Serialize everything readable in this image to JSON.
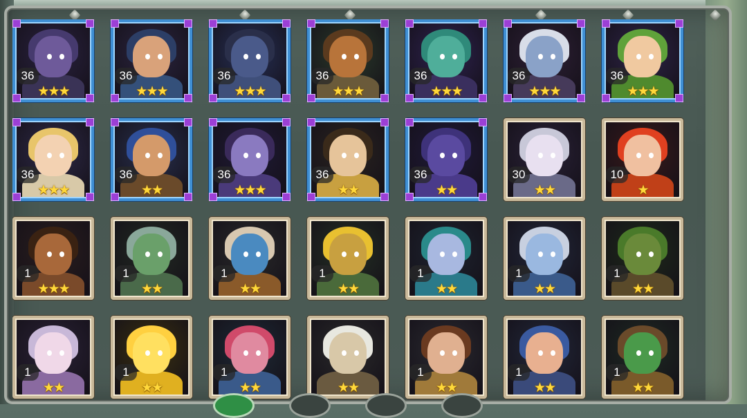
{
  "heroes": [
    {
      "level": "36",
      "stars": 3,
      "frame": "blue",
      "skin": "#6e5a9a",
      "hair": "#463a6e",
      "bg": "#2a2240",
      "outfit": "#3a3356"
    },
    {
      "level": "36",
      "stars": 3,
      "frame": "blue",
      "skin": "#d9a27a",
      "hair": "#2c3e66",
      "bg": "#2b2540",
      "outfit": "#34507a"
    },
    {
      "level": "36",
      "stars": 3,
      "frame": "blue",
      "skin": "#4a5a8a",
      "hair": "#2a2f4a",
      "bg": "#263056",
      "outfit": "#3f4f7a"
    },
    {
      "level": "36",
      "stars": 3,
      "frame": "blue",
      "skin": "#b8743a",
      "hair": "#5a3a1e",
      "bg": "#2a3a2a",
      "outfit": "#6a5a3a"
    },
    {
      "level": "36",
      "stars": 3,
      "frame": "blue",
      "skin": "#4fae9a",
      "hair": "#2f8a7a",
      "bg": "#2e2250",
      "outfit": "#3a2f5e"
    },
    {
      "level": "36",
      "stars": 3,
      "frame": "blue",
      "skin": "#8aa2c8",
      "hair": "#d8dde8",
      "bg": "#2e2036",
      "outfit": "#463a5a"
    },
    {
      "level": "36",
      "stars": 3,
      "frame": "blue",
      "skin": "#f0c9a0",
      "hair": "#5fa23a",
      "bg": "#2e2448",
      "outfit": "#4f8a2e"
    },
    {
      "level": "36",
      "stars": 3,
      "frame": "blue",
      "skin": "#f3d2b2",
      "hair": "#e8c56a",
      "bg": "#2e2a48",
      "outfit": "#d8c9a8"
    },
    {
      "level": "36",
      "stars": 2,
      "frame": "blue",
      "skin": "#d49a6a",
      "hair": "#2f4f9a",
      "bg": "#28304e",
      "outfit": "#6a4a2a"
    },
    {
      "level": "36",
      "stars": 3,
      "frame": "blue",
      "skin": "#8a7ac0",
      "hair": "#3a2a5a",
      "bg": "#1f1a36",
      "outfit": "#4a3a7a"
    },
    {
      "level": "36",
      "stars": 2,
      "frame": "blue",
      "skin": "#e6c49a",
      "hair": "#3a2a1a",
      "bg": "#2a2420",
      "outfit": "#c8a040"
    },
    {
      "level": "36",
      "stars": 2,
      "frame": "blue",
      "skin": "#5a4aa0",
      "hair": "#3e327a",
      "bg": "#201a3a",
      "outfit": "#4a3a8a"
    },
    {
      "level": "30",
      "stars": 2,
      "frame": "gold",
      "skin": "#e8e0f0",
      "hair": "#c8c8d8",
      "bg": "#2a2238",
      "outfit": "#6a6a88"
    },
    {
      "level": "10",
      "stars": 1,
      "frame": "gold",
      "skin": "#f0c0a0",
      "hair": "#e04020",
      "bg": "#3a1a1a",
      "outfit": "#c04018"
    },
    {
      "level": "1",
      "stars": 3,
      "frame": "gold",
      "skin": "#a8683a",
      "hair": "#3a2212",
      "bg": "#2a1e1e",
      "outfit": "#7a4a2a"
    },
    {
      "level": "1",
      "stars": 2,
      "frame": "gold",
      "skin": "#6aa06a",
      "hair": "#8aa89a",
      "bg": "#222a22",
      "outfit": "#4a6a4a"
    },
    {
      "level": "1",
      "stars": 2,
      "frame": "gold",
      "skin": "#4a8ac0",
      "hair": "#d8c8b0",
      "bg": "#2a2a2a",
      "outfit": "#8a5a2a"
    },
    {
      "level": "1",
      "stars": 2,
      "frame": "gold",
      "skin": "#c8a040",
      "hair": "#e8c030",
      "bg": "#243024",
      "outfit": "#4a6a3a"
    },
    {
      "level": "1",
      "stars": 2,
      "frame": "gold",
      "skin": "#a8b8e0",
      "hair": "#2a8a8a",
      "bg": "#1e2430",
      "outfit": "#2a7a8a"
    },
    {
      "level": "1",
      "stars": 2,
      "frame": "gold",
      "skin": "#9ab8e0",
      "hair": "#c8d0e0",
      "bg": "#22283a",
      "outfit": "#3a5a8a"
    },
    {
      "level": "1",
      "stars": 2,
      "frame": "gold",
      "skin": "#6a8a3a",
      "hair": "#4a7a2a",
      "bg": "#1e2a1a",
      "outfit": "#5a4a2a"
    },
    {
      "level": "1",
      "stars": 2,
      "frame": "gold",
      "skin": "#f0d8e8",
      "hair": "#c8b8d8",
      "bg": "#2a2236",
      "outfit": "#8a6aa0"
    },
    {
      "level": "1",
      "stars": 2,
      "frame": "gold",
      "skin": "#ffe060",
      "hair": "#ffd040",
      "bg": "#3a3010",
      "outfit": "#e0b020"
    },
    {
      "level": "1",
      "stars": 2,
      "frame": "gold",
      "skin": "#e08aa0",
      "hair": "#d04a6a",
      "bg": "#1e2a36",
      "outfit": "#3a5a8a"
    },
    {
      "level": "",
      "stars": 2,
      "frame": "gold",
      "skin": "#d8c8a8",
      "hair": "#e8e8e0",
      "bg": "#2a2a2a",
      "outfit": "#6a5a40"
    },
    {
      "level": "1",
      "stars": 2,
      "frame": "gold",
      "skin": "#e0b090",
      "hair": "#6a3a20",
      "bg": "#2a2a30",
      "outfit": "#a07a3a"
    },
    {
      "level": "1",
      "stars": 2,
      "frame": "gold",
      "skin": "#e8b090",
      "hair": "#3a5aa0",
      "bg": "#22283a",
      "outfit": "#3a4a7a"
    },
    {
      "level": "1",
      "stars": 2,
      "frame": "gold",
      "skin": "#4a9a4a",
      "hair": "#6a4a2a",
      "bg": "#1e2a22",
      "outfit": "#7a5a2a"
    }
  ],
  "bottom_buttons": [
    {
      "active": true
    },
    {
      "active": false
    },
    {
      "active": false
    },
    {
      "active": false
    }
  ]
}
